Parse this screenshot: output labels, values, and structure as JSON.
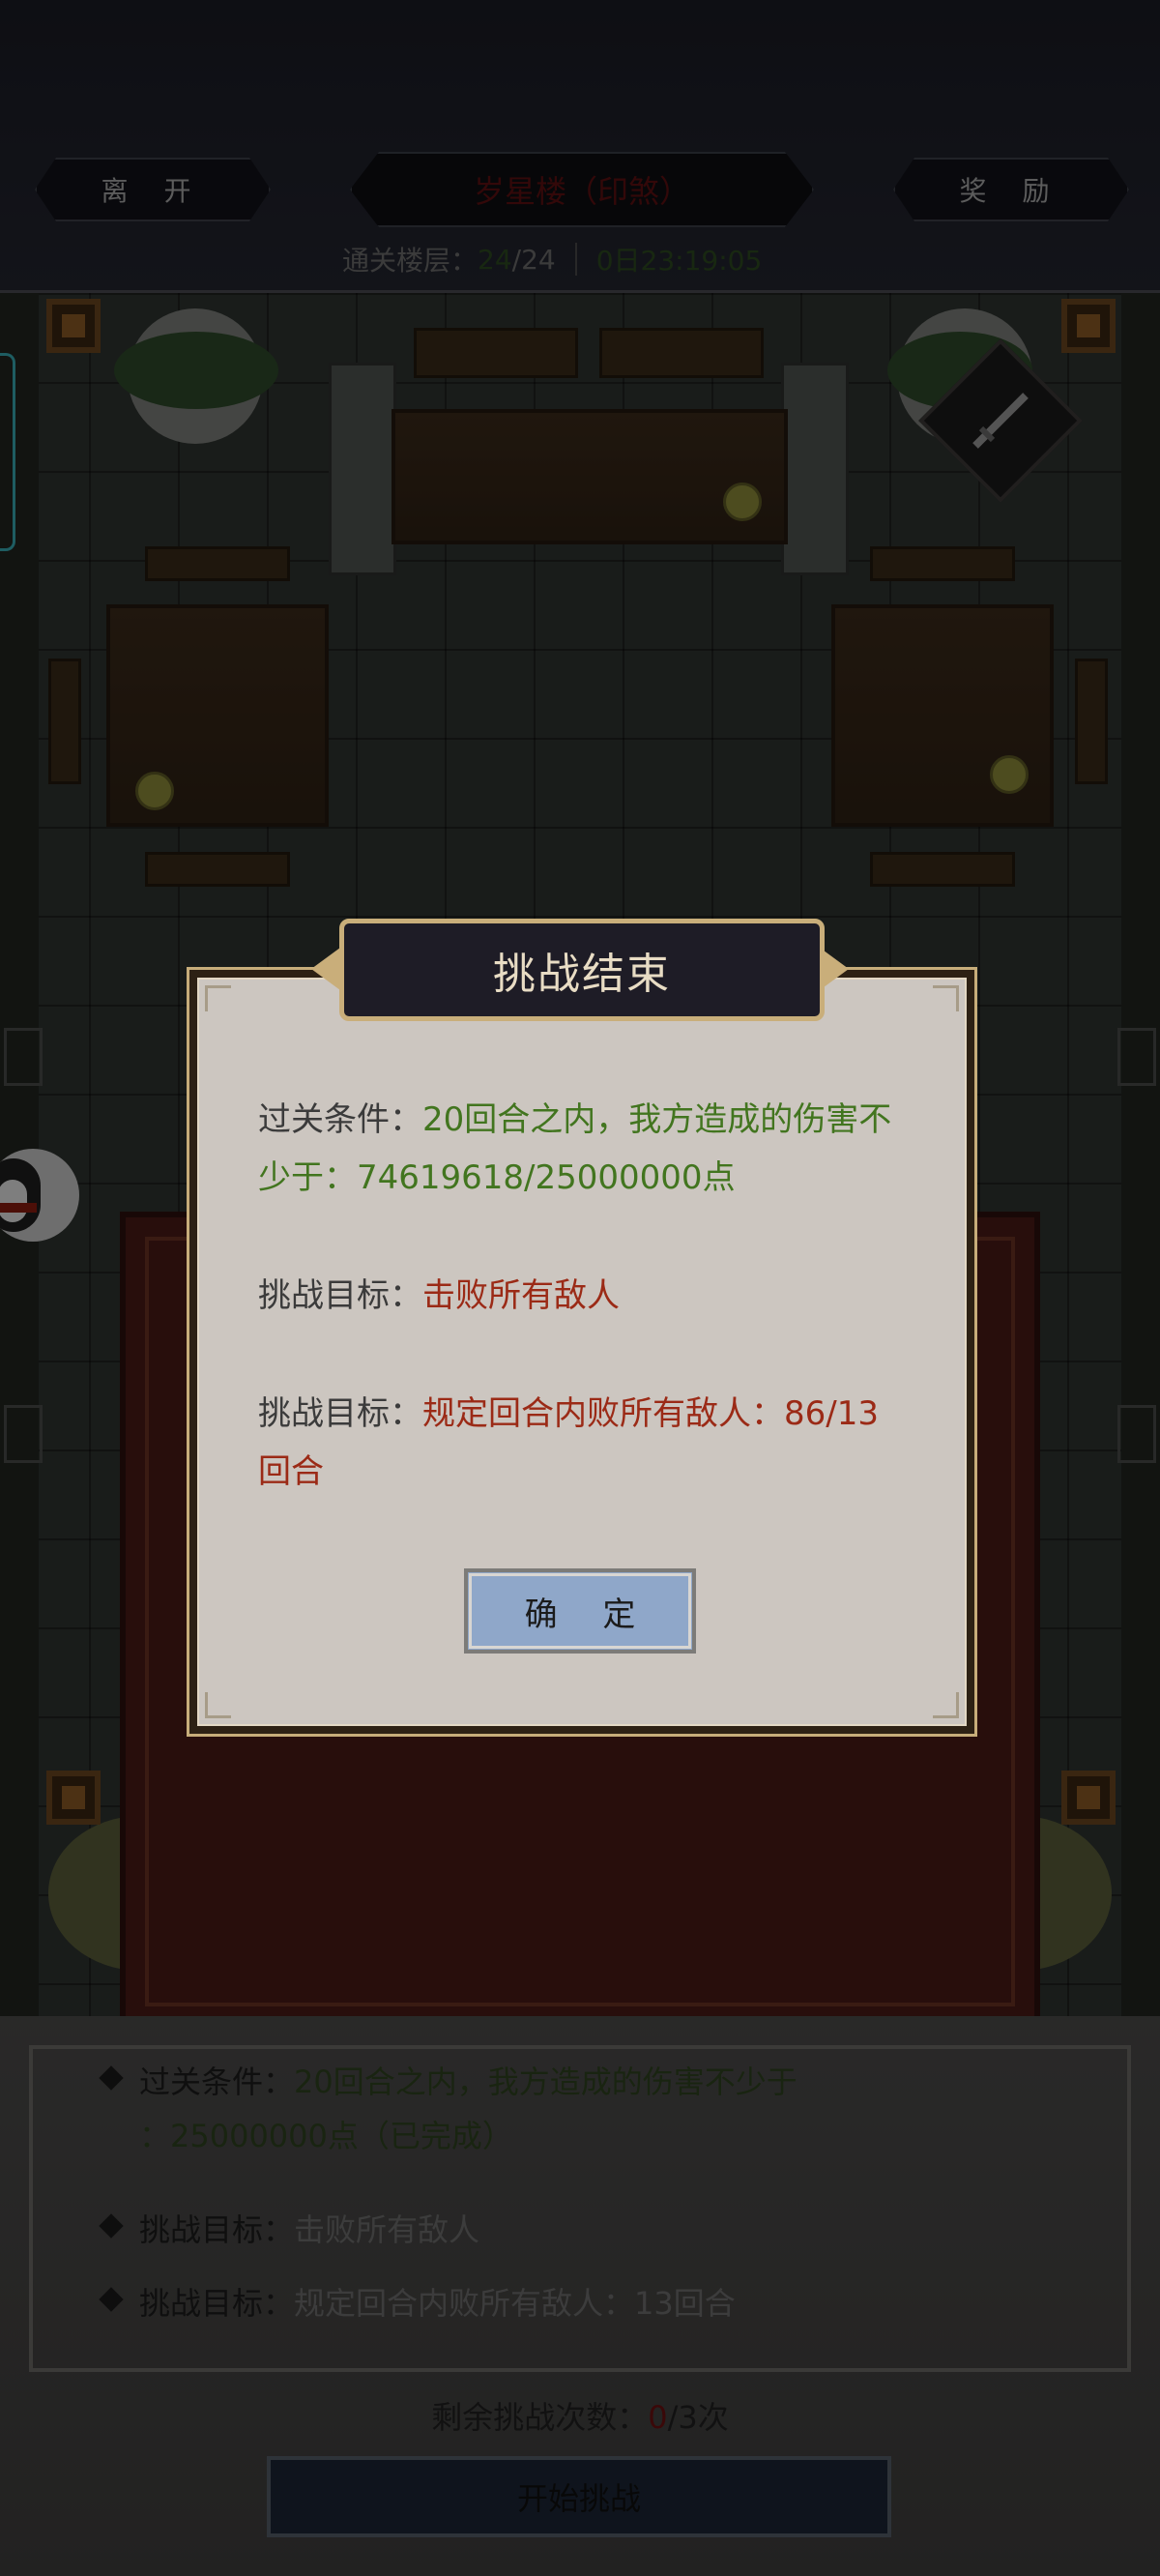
{
  "header": {
    "leave_label": "离 开",
    "tower_title": "岁星楼（印煞）",
    "reward_label": "奖 励",
    "floor_label": "通关楼层：",
    "floor_current": "24",
    "floor_total": "/24",
    "timer": "0日23:19:05"
  },
  "modal": {
    "title": "挑战结束",
    "line1_label": "过关条件：",
    "line1_value_a": "20回合之内，我方造成的伤害不",
    "line1_value_b": "少于：74619618/25000000点",
    "line2_label": "挑战目标：",
    "line2_value": "击败所有敌人",
    "line3_label": "挑战目标：",
    "line3_value_a": "规定回合内败所有敌人：86/13",
    "line3_value_b": "回合",
    "confirm_label": "确 定"
  },
  "panel": {
    "cond1_label": "过关条件：",
    "cond1_value_a": "20回合之内，我方造成的伤害不少于",
    "cond1_value_b": "：25000000点（已完成）",
    "cond2_label": "挑战目标：",
    "cond2_value": "击败所有敌人",
    "cond3_label": "挑战目标：",
    "cond3_value": "规定回合内败所有敌人：13回合",
    "remaining_label": "剩余挑战次数：",
    "remaining_used": "0",
    "remaining_total": "/3次",
    "start_label": "开始挑战"
  },
  "colors": {
    "accent_gold": "#c9ae7a",
    "condition_green": "#42751f",
    "target_red": "#9b2a16",
    "confirm_blue": "#8fa7c9"
  },
  "icons": [
    "penguin-icon",
    "sword-icon",
    "diamond-bullet-icon"
  ]
}
